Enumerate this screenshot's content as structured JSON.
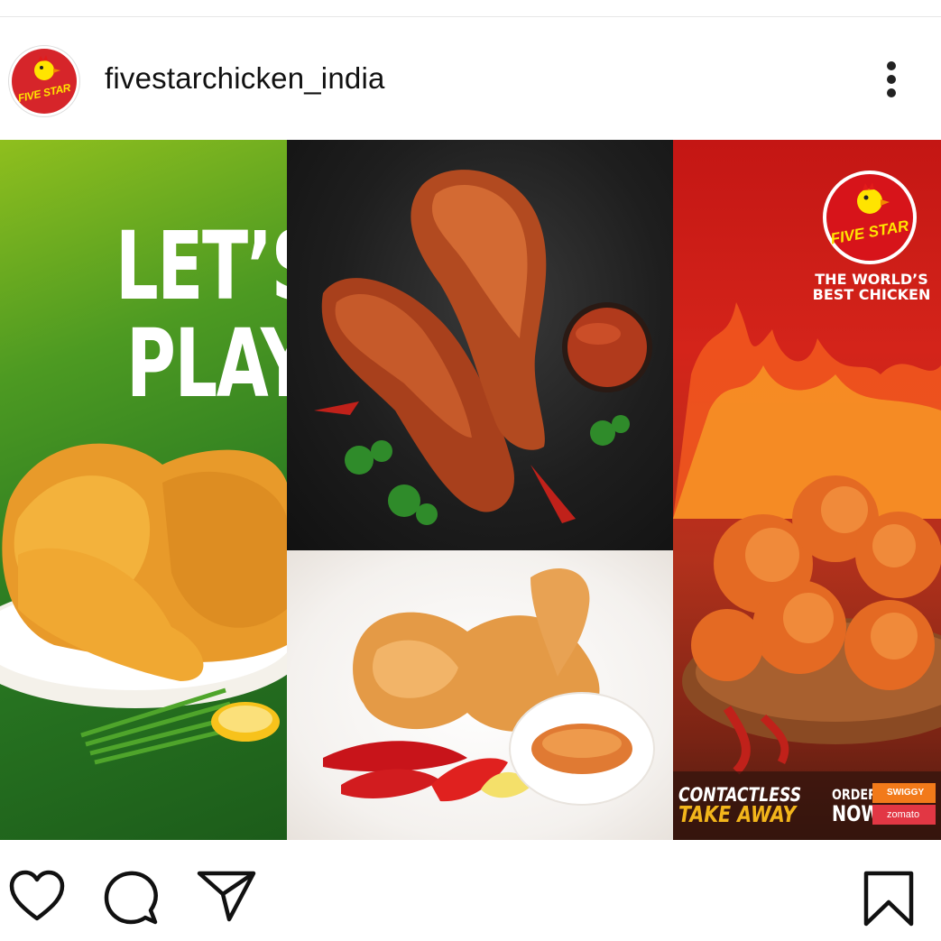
{
  "profile": {
    "username": "fivestarchicken_india",
    "avatar_text": "FIVE STAR"
  },
  "post": {
    "headline_line1": "LET’S",
    "headline_line2": "PLAY",
    "badge_text": "FIVE STAR",
    "tagline_line1": "THE WORLD’S",
    "tagline_line2": "BEST CHICKEN",
    "contactless": "CONTACTLESS",
    "takeaway": "TAKE AWAY",
    "order": "ORDER",
    "now": "NOW",
    "swiggy": "SWIGGY",
    "zomato": "zomato"
  },
  "icons": {
    "more": "more-options-icon",
    "like": "heart-icon",
    "comment": "comment-icon",
    "share": "share-icon",
    "save": "bookmark-icon"
  },
  "colors": {
    "brand_red": "#d6252a",
    "brand_yellow": "#ffe400",
    "text": "#111111"
  }
}
